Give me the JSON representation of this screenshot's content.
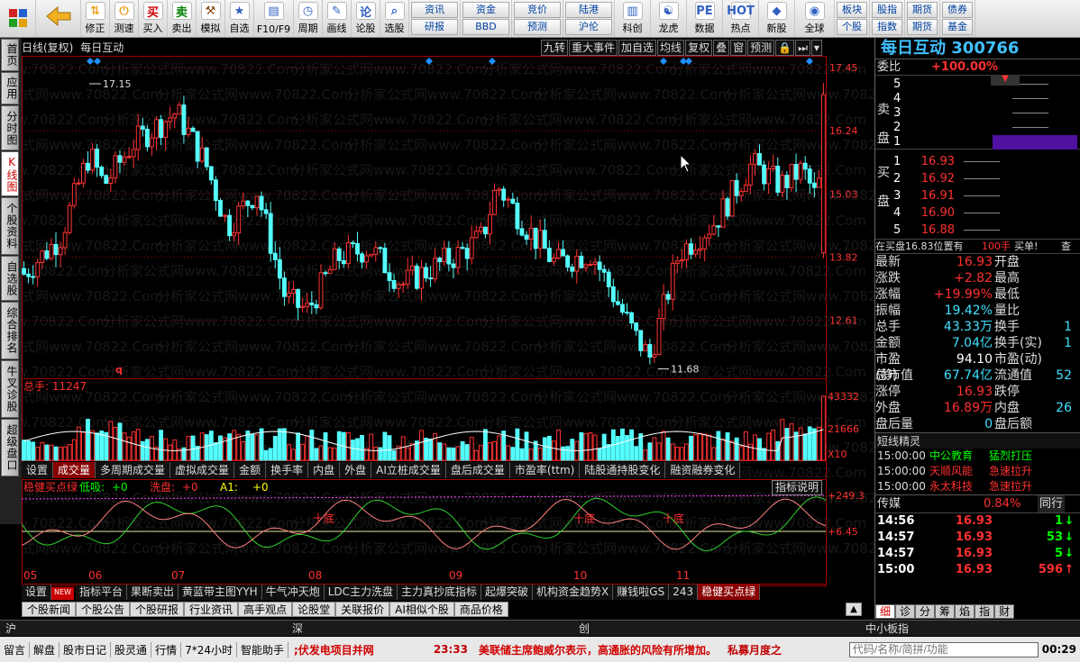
{
  "toolbar": {
    "buttons": [
      {
        "label": "修正",
        "icon": "up-down-arrows-icon",
        "color": "#e8a020"
      },
      {
        "label": "测速",
        "icon": "power-icon",
        "color": "#e8a020"
      },
      {
        "label": "买入",
        "icon": "buy-icon",
        "glyph": "买",
        "color": "#d00000"
      },
      {
        "label": "卖出",
        "icon": "sell-icon",
        "glyph": "卖",
        "color": "#008000"
      },
      {
        "label": "模拟",
        "icon": "hammer-icon",
        "color": "#8a4a10"
      },
      {
        "label": "自选",
        "icon": "star-icon",
        "color": "#3060c0"
      },
      {
        "label": "F10/F9",
        "icon": "f10-icon",
        "color": "#3060c0"
      },
      {
        "label": "周期",
        "icon": "clock-icon",
        "color": "#3060c0"
      },
      {
        "label": "画线",
        "icon": "pencil-icon",
        "color": "#3060c0"
      },
      {
        "label": "论股",
        "icon": "chat-icon",
        "glyph": "论",
        "color": "#3060c0"
      },
      {
        "label": "选股",
        "icon": "magnifier-icon",
        "color": "#3060c0"
      }
    ],
    "pairs": [
      [
        "资讯",
        "研报"
      ],
      [
        "资金",
        "BBD"
      ],
      [
        "竞价",
        "预测"
      ],
      [
        "陆港",
        "沪伦"
      ]
    ],
    "buttons2": [
      {
        "label": "科创",
        "icon": "chart-icon"
      },
      {
        "label": "龙虎",
        "icon": "dragon-icon"
      },
      {
        "label": "数据",
        "icon": "pe-icon",
        "glyph": "PE"
      },
      {
        "label": "热点",
        "icon": "hot-icon",
        "glyph": "HOT"
      },
      {
        "label": "新股",
        "icon": "ipo-icon"
      },
      {
        "label": "全球",
        "icon": "globe-icon"
      }
    ],
    "pairs2": [
      [
        "板块",
        "个股"
      ],
      [
        "股指",
        "指数"
      ],
      [
        "期货",
        "期货"
      ],
      [
        "债券",
        "基金"
      ]
    ]
  },
  "sidetabs": [
    "首页",
    "应用",
    "分时图",
    "K线图",
    "个股资料",
    "自选股",
    "综合排名",
    "牛叉诊股",
    "超级盘口"
  ],
  "chart_header": {
    "title": "日线(复权)",
    "stock": "每日互动",
    "buttons": [
      "九转",
      "重大事件",
      "加自选",
      "均线",
      "复权",
      "叠",
      "窗",
      "预测",
      "🔒",
      "⏭",
      "▾"
    ]
  },
  "chart_data": {
    "type": "candlestick",
    "price_labels": [
      "17.45",
      "16.24",
      "15.03",
      "13.82",
      "12.61"
    ],
    "high_mark": "17.15",
    "low_mark": "11.68",
    "volume_label": "总手: 11247",
    "volume_ticks": [
      "43332",
      "21666",
      "X10"
    ],
    "indicator_title": "稳健买点绿",
    "indicator_params": [
      {
        "name": "低吸:",
        "value": "+0"
      },
      {
        "name": "洗盘:",
        "value": "+0"
      },
      {
        "name": "A1:",
        "value": "+0"
      }
    ],
    "indicator_ticks": [
      "+249.3",
      "+6.45"
    ],
    "indicator_marks": [
      "十底",
      "十底",
      "十底"
    ],
    "months": [
      "05",
      "06",
      "07",
      "08",
      "09",
      "10",
      "11"
    ],
    "ylim": [
      11.5,
      17.5
    ]
  },
  "vol_tabs": [
    "设置",
    "成交量",
    "多周期成交量",
    "虚拟成交量",
    "金额",
    "换手率",
    "内盘",
    "外盘",
    "AI立桩成交量",
    "盘后成交量",
    "市盈率(ttm)",
    "陆股通持股变化",
    "融资融券变化"
  ],
  "indicator_button": "指标说明",
  "ind_tabs": [
    "设置",
    "指标平台",
    "果断卖出",
    "黄蓝带主图YYH",
    "牛气冲天炮",
    "LDC主力洗盘",
    "主力真抄底指标",
    "起爆突破",
    "机构资金趋势X",
    "赚钱啦GS",
    "243",
    "稳健买点绿"
  ],
  "ind_new_badge": "NEW",
  "info_tabs": [
    "个股新闻",
    "个股公告",
    "个股研报",
    "行业资讯",
    "高手观点",
    "论股堂",
    "关联报价",
    "AI相似个股",
    "商品价格"
  ],
  "market_bar": [
    "沪",
    "深",
    "创",
    "中小板指"
  ],
  "statusbar": {
    "items": [
      "留言",
      "解盘",
      "股市日记",
      "股灵通",
      "行情",
      "7*24小时",
      "智能助手"
    ],
    "news1": ";伏发电项目并网",
    "time": "23:33",
    "news2": "美联储主席鲍威尔表示，高通胀的风险有所增加。",
    "news3": "私募月度之",
    "search_placeholder": "代码/名称/简拼/功能",
    "clock": "00:29"
  },
  "right": {
    "title": "每日互动 300766",
    "weibi_label": "委比",
    "weibi": "+100.00%",
    "sell_label": [
      "卖",
      "盘"
    ],
    "sells": [
      {
        "lv": "5",
        "px": "",
        "vol": ""
      },
      {
        "lv": "4",
        "px": "",
        "vol": ""
      },
      {
        "lv": "3",
        "px": "",
        "vol": ""
      },
      {
        "lv": "2",
        "px": "",
        "vol": ""
      },
      {
        "lv": "1",
        "px": "",
        "vol": ""
      }
    ],
    "buy_label": [
      "买",
      "盘"
    ],
    "buys": [
      {
        "lv": "1",
        "px": "16.93"
      },
      {
        "lv": "2",
        "px": "16.92"
      },
      {
        "lv": "3",
        "px": "16.91"
      },
      {
        "lv": "4",
        "px": "16.90"
      },
      {
        "lv": "5",
        "px": "16.88"
      }
    ],
    "order_note": "在买盘16.83位置有",
    "order_vol": "100手",
    "order_type": "买单!",
    "order_more": "查",
    "stats": [
      {
        "k": "最新",
        "v": "16.93",
        "c": "red",
        "k2": "开盘",
        "v2": ""
      },
      {
        "k": "涨跌",
        "v": "+2.82",
        "c": "red",
        "k2": "最高",
        "v2": ""
      },
      {
        "k": "涨幅",
        "v": "+19.99%",
        "c": "red",
        "k2": "最低",
        "v2": ""
      },
      {
        "k": "振幅",
        "v": "19.42%",
        "c": "cyan",
        "k2": "量比",
        "v2": ""
      },
      {
        "k": "总手",
        "v": "43.33万",
        "c": "cyan",
        "k2": "换手",
        "v2": "1"
      },
      {
        "k": "金额",
        "v": "7.04亿",
        "c": "cyan",
        "k2": "换手(实)",
        "v2": "1"
      },
      {
        "k": "市盈(静)",
        "v": "94.10",
        "c": "white",
        "k2": "市盈(动)",
        "v2": ""
      },
      {
        "k": "总市值",
        "v": "67.74亿",
        "c": "cyan",
        "k2": "流通值",
        "v2": "52"
      },
      {
        "k": "涨停",
        "v": "16.93",
        "c": "red",
        "k2": "跌停",
        "v2": ""
      },
      {
        "k": "外盘",
        "v": "16.89万",
        "c": "red",
        "k2": "内盘",
        "v2": "26"
      },
      {
        "k": "盘后量",
        "v": "0",
        "c": "cyan",
        "k2": "盘后额",
        "v2": ""
      }
    ],
    "alerts_title": "短线精灵",
    "alerts": [
      {
        "t": "15:00:00",
        "name": "中公教育",
        "sig": "猛烈打压",
        "c": "green"
      },
      {
        "t": "15:00:00",
        "name": "天顺风能",
        "sig": "急速拉升",
        "c": "red"
      },
      {
        "t": "15:00:00",
        "name": "永太科技",
        "sig": "急速拉升",
        "c": "red"
      }
    ],
    "sector": {
      "name": "传媒",
      "pct": "0.84%",
      "more": "同行"
    },
    "trades": [
      {
        "t": "14:56",
        "px": "16.93",
        "vol": "1",
        "dir": "↓",
        "c": "green"
      },
      {
        "t": "14:57",
        "px": "16.93",
        "vol": "53",
        "dir": "↓",
        "c": "green"
      },
      {
        "t": "14:57",
        "px": "16.93",
        "vol": "5",
        "dir": "↓",
        "c": "green"
      },
      {
        "t": "15:00",
        "px": "16.93",
        "vol": "596",
        "dir": "↑",
        "c": "red"
      }
    ],
    "tabs": [
      "细",
      "诊",
      "分",
      "筹",
      "焰",
      "指",
      "财"
    ]
  },
  "watermark": "分析家公式网www.70822.Com"
}
